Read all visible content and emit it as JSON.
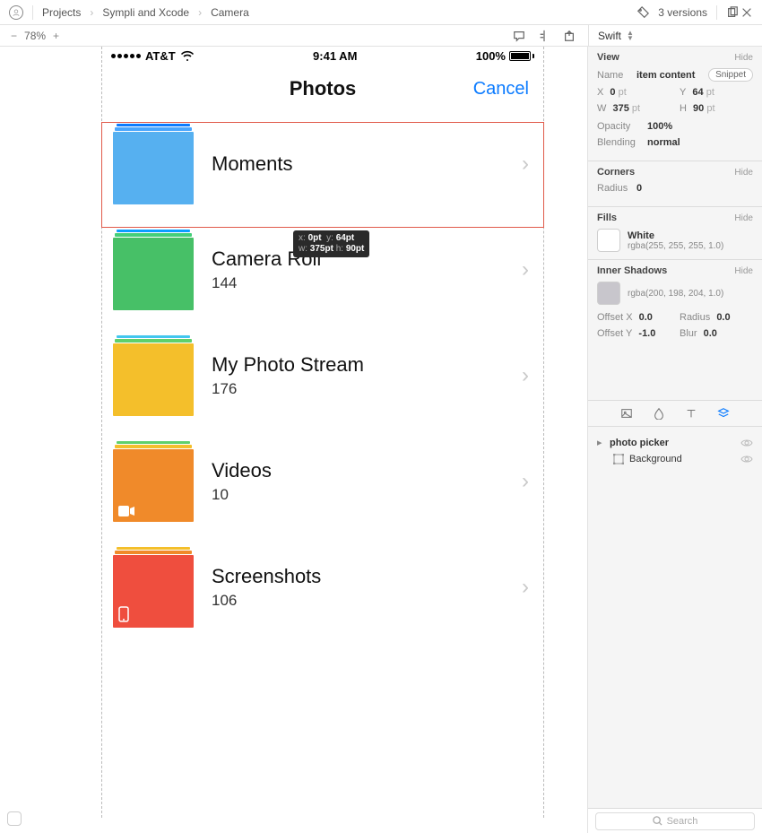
{
  "breadcrumb": {
    "root": "Projects",
    "mid": "Sympli and Xcode",
    "leaf": "Camera"
  },
  "versions_label": "3 versions",
  "zoom": {
    "percent": "78%"
  },
  "lang": {
    "name": "Swift"
  },
  "statusbar": {
    "carrier": "AT&T",
    "time": "9:41 AM",
    "battery": "100%"
  },
  "navbar": {
    "title": "Photos",
    "cancel": "Cancel"
  },
  "tooltip": {
    "x_label": "x:",
    "x_val": "0pt",
    "y_label": "y:",
    "y_val": "64pt",
    "w_label": "w:",
    "w_val": "375pt",
    "h_label": "h:",
    "h_val": "90pt"
  },
  "rows": [
    {
      "title": "Moments",
      "count": "",
      "colors": {
        "top": "#0b7bff",
        "mid": "#49a6ff",
        "main": "#56b0f0"
      },
      "icon": ""
    },
    {
      "title": "Camera Roll",
      "count": "144",
      "colors": {
        "top": "#0b9eff",
        "mid": "#44cf79",
        "main": "#47c067"
      },
      "icon": ""
    },
    {
      "title": "My Photo Stream",
      "count": "176",
      "colors": {
        "top": "#42c6ef",
        "mid": "#5fd06b",
        "main": "#f4bf2b"
      },
      "icon": ""
    },
    {
      "title": "Videos",
      "count": "10",
      "colors": {
        "top": "#5fd06b",
        "mid": "#f4bf2b",
        "main": "#f08a2a"
      },
      "icon": "video"
    },
    {
      "title": "Screenshots",
      "count": "106",
      "colors": {
        "top": "#f4bf2b",
        "mid": "#f08a2a",
        "main": "#ef4e3e"
      },
      "icon": "phone"
    }
  ],
  "insp": {
    "view": {
      "header": "View",
      "hide": "Hide",
      "name_k": "Name",
      "name_v": "item content",
      "snippet": "Snippet",
      "x_k": "X",
      "x_v": "0",
      "y_k": "Y",
      "y_v": "64",
      "w_k": "W",
      "w_v": "375",
      "h_k": "H",
      "h_v": "90",
      "unit": "pt",
      "opacity_k": "Opacity",
      "opacity_v": "100%",
      "blend_k": "Blending",
      "blend_v": "normal"
    },
    "corners": {
      "header": "Corners",
      "hide": "Hide",
      "radius_k": "Radius",
      "radius_v": "0"
    },
    "fills": {
      "header": "Fills",
      "hide": "Hide",
      "name": "White",
      "rgba": "rgba(255, 255, 255, 1.0)",
      "swatch": "#ffffff"
    },
    "shadows": {
      "header": "Inner Shadows",
      "hide": "Hide",
      "rgba": "rgba(200, 198, 204, 1.0)",
      "swatch": "#c8c6cc",
      "ox_k": "Offset X",
      "ox_v": "0.0",
      "rad_k": "Radius",
      "rad_v": "0.0",
      "oy_k": "Offset Y",
      "oy_v": "-1.0",
      "blur_k": "Blur",
      "blur_v": "0.0"
    },
    "layers": {
      "root": "photo picker",
      "child": "Background"
    },
    "search_placeholder": "Search"
  }
}
